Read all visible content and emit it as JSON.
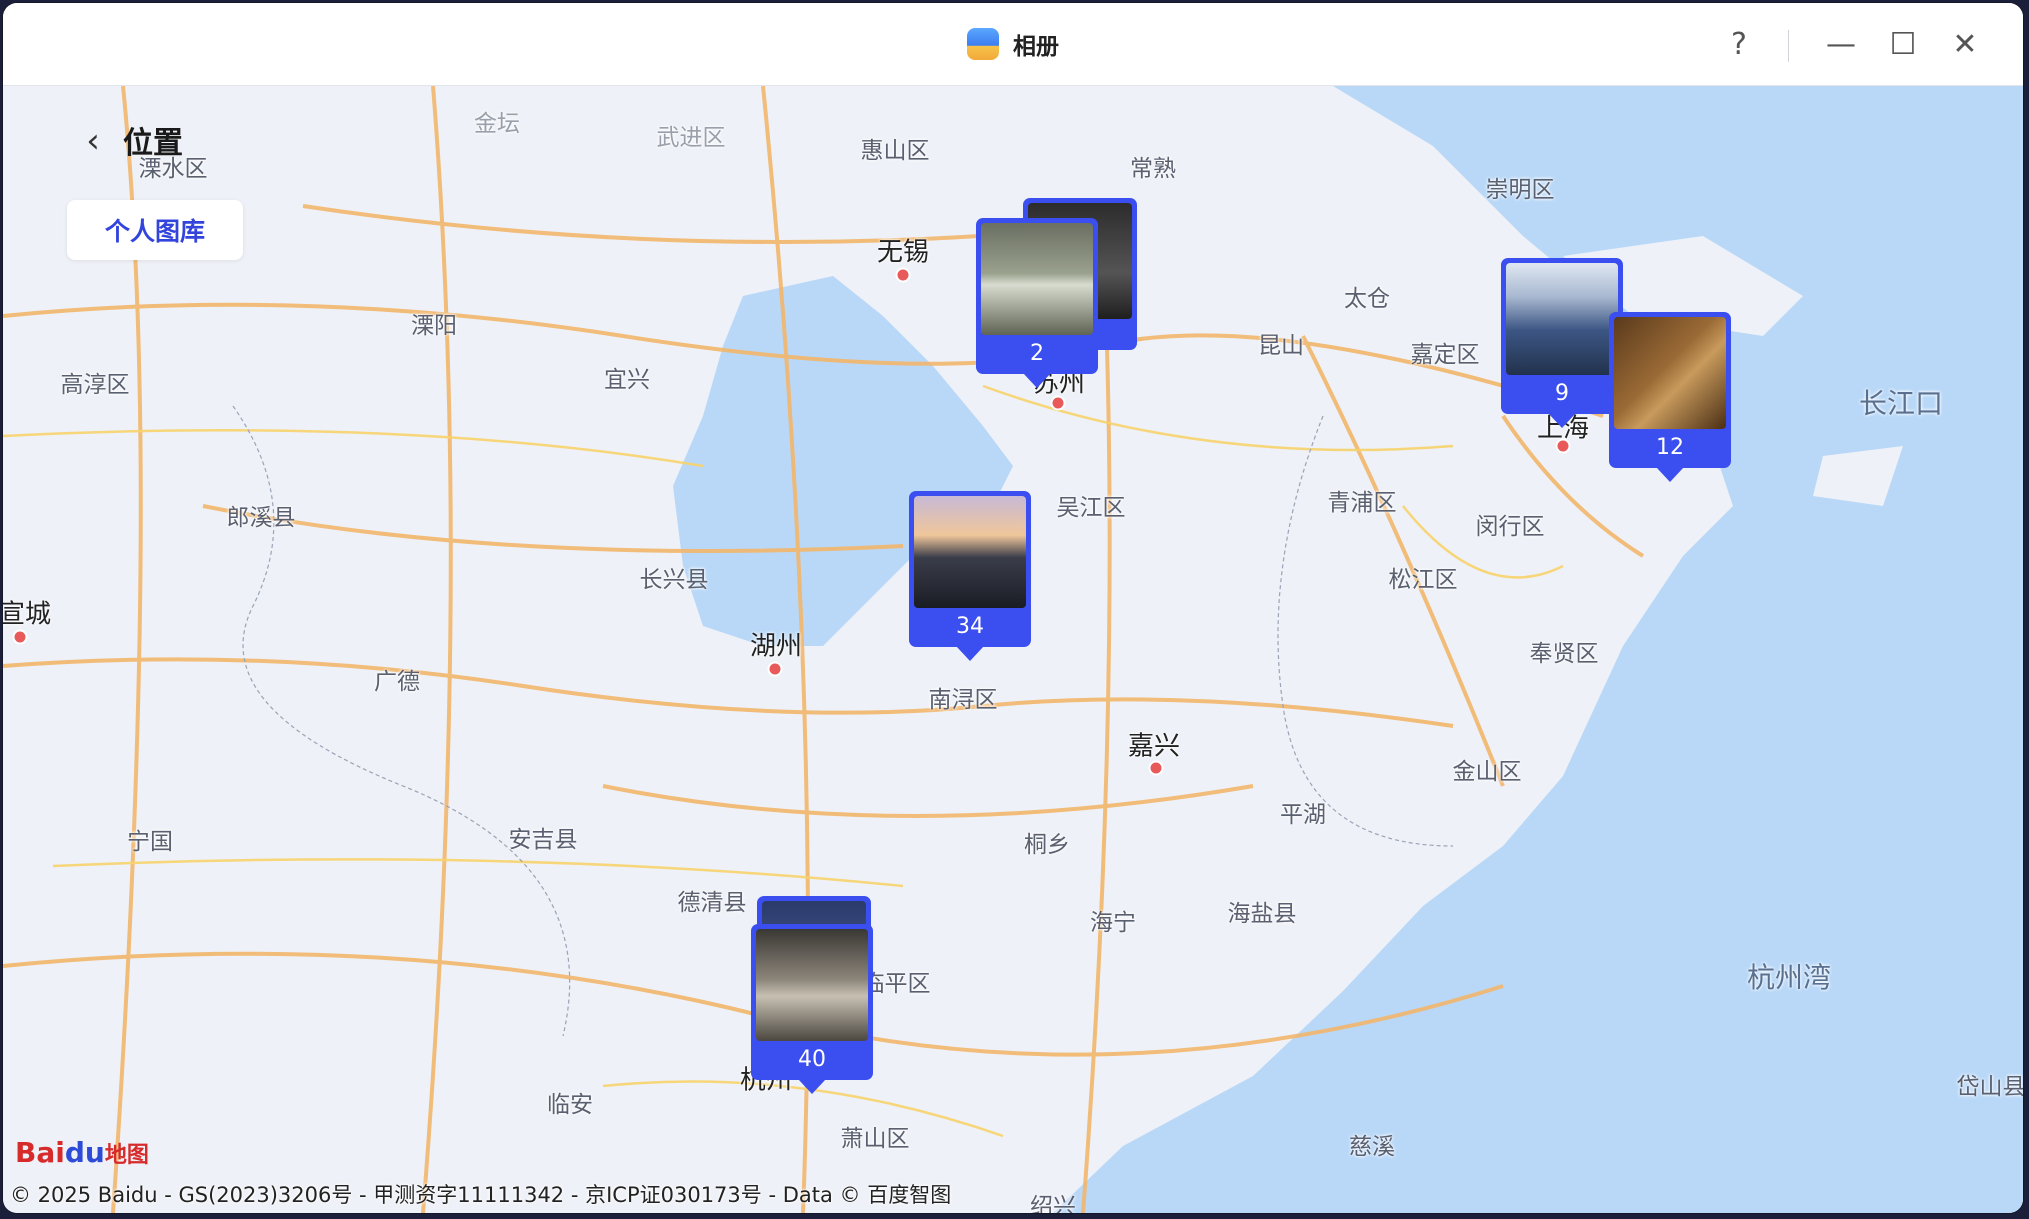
{
  "window": {
    "title": "相册",
    "help_icon": "?",
    "minimize_icon": "—",
    "maximize_icon": "☐",
    "close_icon": "✕"
  },
  "header": {
    "back_icon": "‹",
    "title": "位置",
    "library_button": "个人图库"
  },
  "map": {
    "places": [
      {
        "name": "金坛",
        "style": "faint"
      },
      {
        "name": "武进区",
        "style": "faint"
      },
      {
        "name": "惠山区",
        "style": "normal"
      },
      {
        "name": "常熟",
        "style": "normal"
      },
      {
        "name": "崇明区",
        "style": "normal"
      },
      {
        "name": "溧水区",
        "style": "normal"
      },
      {
        "name": "无锡",
        "style": "city"
      },
      {
        "name": "太仓",
        "style": "normal"
      },
      {
        "name": "溧阳",
        "style": "normal"
      },
      {
        "name": "昆山",
        "style": "normal"
      },
      {
        "name": "嘉定区",
        "style": "normal"
      },
      {
        "name": "高淳区",
        "style": "normal"
      },
      {
        "name": "宜兴",
        "style": "normal"
      },
      {
        "name": "苏州",
        "style": "city"
      },
      {
        "name": "长江口",
        "style": "sea"
      },
      {
        "name": "上海",
        "style": "city"
      },
      {
        "name": "吴江区",
        "style": "normal"
      },
      {
        "name": "青浦区",
        "style": "normal"
      },
      {
        "name": "郎溪县",
        "style": "normal"
      },
      {
        "name": "闵行区",
        "style": "normal"
      },
      {
        "name": "长兴县",
        "style": "normal"
      },
      {
        "name": "松江区",
        "style": "normal"
      },
      {
        "name": "宣城",
        "style": "city"
      },
      {
        "name": "湖州",
        "style": "city"
      },
      {
        "name": "奉贤区",
        "style": "normal"
      },
      {
        "name": "广德",
        "style": "normal"
      },
      {
        "name": "南浔区",
        "style": "normal"
      },
      {
        "name": "嘉兴",
        "style": "city"
      },
      {
        "name": "金山区",
        "style": "normal"
      },
      {
        "name": "平湖",
        "style": "normal"
      },
      {
        "name": "宁国",
        "style": "normal"
      },
      {
        "name": "安吉县",
        "style": "normal"
      },
      {
        "name": "桐乡",
        "style": "normal"
      },
      {
        "name": "德清县",
        "style": "normal"
      },
      {
        "name": "海盐县",
        "style": "normal"
      },
      {
        "name": "海宁",
        "style": "normal"
      },
      {
        "name": "杭州湾",
        "style": "sea"
      },
      {
        "name": "临平区",
        "style": "normal"
      },
      {
        "name": "杭州",
        "style": "city"
      },
      {
        "name": "临安",
        "style": "normal"
      },
      {
        "name": "萧山区",
        "style": "normal"
      },
      {
        "name": "慈溪",
        "style": "normal"
      },
      {
        "name": "岱山县",
        "style": "normal"
      },
      {
        "name": "绍兴",
        "style": "normal"
      }
    ],
    "clusters": [
      {
        "count": "2",
        "photo": "ceramics-exhibit"
      },
      {
        "count": "9",
        "photo": "building"
      },
      {
        "count": "12",
        "photo": "sign-board"
      },
      {
        "count": "34",
        "photo": "canal-town"
      },
      {
        "count": "40",
        "photo": "shop-interior"
      }
    ],
    "logo_text": "Bai",
    "logo_paw": "du",
    "logo_cn": "地图",
    "copyright": "© 2025 Baidu - GS(2023)3206号 - 甲测资字11111342 - 京ICP证030173号 - Data © 百度智图"
  },
  "colors": {
    "accent": "#3b4ef0",
    "water": "#b9d8f7",
    "land": "#eef1f7",
    "road": "#f2b66b"
  }
}
